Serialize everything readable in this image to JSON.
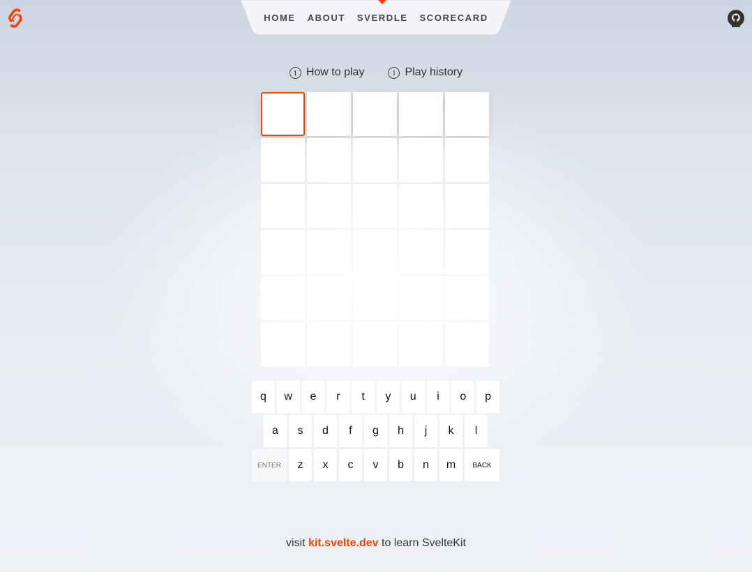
{
  "nav": {
    "items": [
      {
        "label": "HOME"
      },
      {
        "label": "ABOUT"
      },
      {
        "label": "SVERDLE",
        "active": true
      },
      {
        "label": "SCORECARD"
      }
    ]
  },
  "icons": {
    "logo": "svelte-logo-icon",
    "github": "github-icon",
    "info": "info-icon"
  },
  "colors": {
    "accent": "#ff3e00",
    "tile": "#ffffff"
  },
  "links": {
    "how_to_play": "How to play",
    "play_history": "Play history",
    "info_glyph": "i"
  },
  "board": {
    "rows": 6,
    "columns": 5,
    "current_row": 1,
    "selected_column": 1,
    "guesses": []
  },
  "keyboard": {
    "row1": [
      "q",
      "w",
      "e",
      "r",
      "t",
      "y",
      "u",
      "i",
      "o",
      "p"
    ],
    "row2": [
      "a",
      "s",
      "d",
      "f",
      "g",
      "h",
      "j",
      "k",
      "l"
    ],
    "row3": [
      "z",
      "x",
      "c",
      "v",
      "b",
      "n",
      "m"
    ],
    "enter_label": "ENTER",
    "back_label": "BACK"
  },
  "footer": {
    "prefix": "visit",
    "link_text": "kit.svelte.dev",
    "suffix": "to learn SvelteKit"
  }
}
